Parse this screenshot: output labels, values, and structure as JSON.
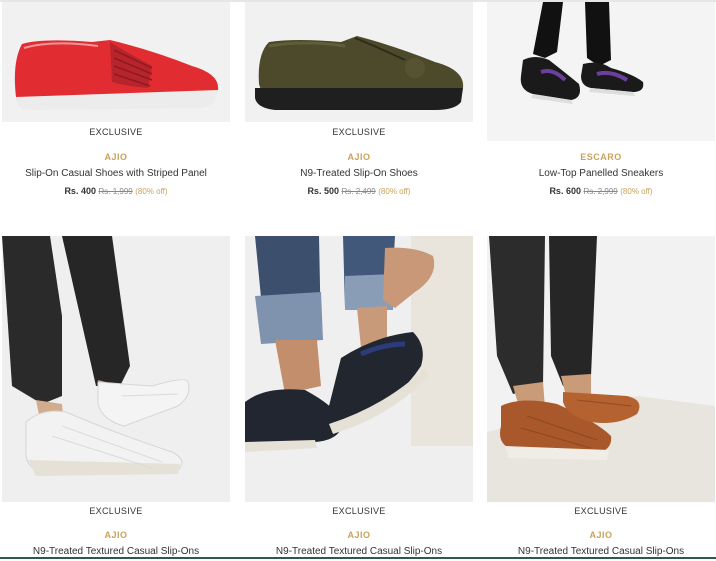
{
  "products": [
    {
      "badge": "EXCLUSIVE",
      "brand": "AJIO",
      "name": "Slip-On Casual Shoes with Striped Panel",
      "price": "Rs. 400",
      "was": "Rs. 1,999",
      "off": "(80% off)",
      "image": "red-slip-on-shoe"
    },
    {
      "badge": "EXCLUSIVE",
      "brand": "AJIO",
      "name": "N9-Treated Slip-On Shoes",
      "price": "Rs. 500",
      "was": "Rs. 2,499",
      "off": "(80% off)",
      "image": "olive-slip-on-shoe"
    },
    {
      "badge": "",
      "brand": "ESCARO",
      "name": "Low-Top Panelled Sneakers",
      "price": "Rs. 600",
      "was": "Rs. 2,999",
      "off": "(80% off)",
      "image": "black-purple-sneakers"
    },
    {
      "badge": "EXCLUSIVE",
      "brand": "AJIO",
      "name": "N9-Treated Textured Casual Slip-Ons",
      "price": "",
      "was": "",
      "off": "",
      "image": "white-textured-slip-on"
    },
    {
      "badge": "EXCLUSIVE",
      "brand": "AJIO",
      "name": "N9-Treated Textured Casual Slip-Ons",
      "price": "",
      "was": "",
      "off": "",
      "image": "black-textured-slip-on"
    },
    {
      "badge": "EXCLUSIVE",
      "brand": "AJIO",
      "name": "N9-Treated Textured Casual Slip-Ons",
      "price": "",
      "was": "",
      "off": "",
      "image": "tan-textured-slip-on"
    }
  ],
  "colors": {
    "brand": "#c9a25c",
    "text": "#333333",
    "strike": "#888888"
  }
}
